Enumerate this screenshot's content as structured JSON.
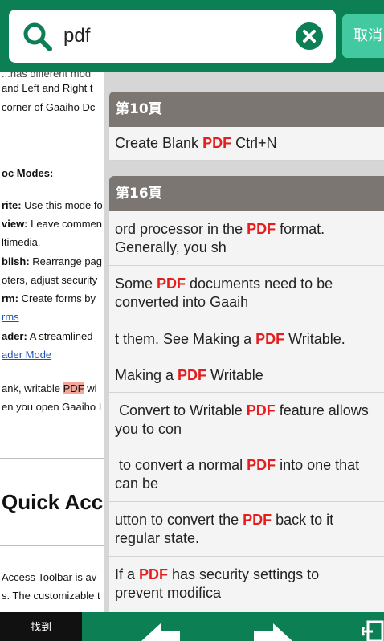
{
  "search": {
    "query": "pdf",
    "cancel_label": "取消"
  },
  "document": {
    "lines": [
      {
        "text": "...has different mod",
        "style": "partial"
      },
      {
        "text": "and Left and Right t"
      },
      {
        "text": "corner of Gaaiho Dc"
      },
      {
        "text": "oc Modes:",
        "bold": true
      },
      {
        "label": "rite:",
        "text": " Use this mode fo"
      },
      {
        "label": "view:",
        "text": " Leave commen"
      },
      {
        "text": "ltimedia."
      },
      {
        "label": "blish:",
        "text": " Rearrange pag"
      },
      {
        "text": "oters, adjust security"
      },
      {
        "label": "rm:",
        "text": " Create forms by"
      },
      {
        "text": "rms",
        "link": true
      },
      {
        "label": "ader:",
        "text": " A streamlined"
      },
      {
        "text": "ader Mode",
        "link": true
      },
      {
        "pre": "ank, writable ",
        "hit": "PDF",
        "post": " wi"
      },
      {
        "text": "en you open Gaaiho I"
      }
    ],
    "heading": "Quick Acce",
    "footer_lines": [
      "Access Toolbar is av",
      "s. The customizable t"
    ]
  },
  "results": [
    {
      "page_label": "第10頁",
      "items": [
        {
          "pre": "Create Blank ",
          "hit": "PDF",
          "post": " Ctrl+N"
        }
      ]
    },
    {
      "page_label": "第16頁",
      "items": [
        {
          "pre": "ord processor in the ",
          "hit": "PDF",
          "post": " format.\nGenerally, you sh"
        },
        {
          "pre": "Some ",
          "hit": "PDF",
          "post": " documents need to be\nconverted into Gaaih"
        },
        {
          "pre": "t them. See Making a ",
          "hit": "PDF",
          "post": " Writable."
        },
        {
          "pre": "Making a ",
          "hit": "PDF",
          "post": " Writable"
        },
        {
          "pre": " Convert to Writable ",
          "hit": "PDF",
          "post": " feature allows\nyou to con"
        },
        {
          "pre": " to convert a normal ",
          "hit": "PDF",
          "post": " into one that\ncan be"
        },
        {
          "pre": "utton to convert the ",
          "hit": "PDF",
          "post": " back to it\nregular state."
        },
        {
          "pre": "If a ",
          "hit": "PDF",
          "post": " has security settings to\nprevent modifica"
        }
      ]
    }
  ],
  "bottom": {
    "find_label": "找到"
  },
  "colors": {
    "brand_green": "#0d7f55",
    "accent_mint": "#43c9a0",
    "hit_red": "#e41e1e",
    "group_header": "#7c7673"
  },
  "icons": {
    "search": "search-icon",
    "clear": "clear-icon",
    "previous": "arrow-left-icon",
    "next": "arrow-right-icon",
    "exit": "exit-icon"
  }
}
